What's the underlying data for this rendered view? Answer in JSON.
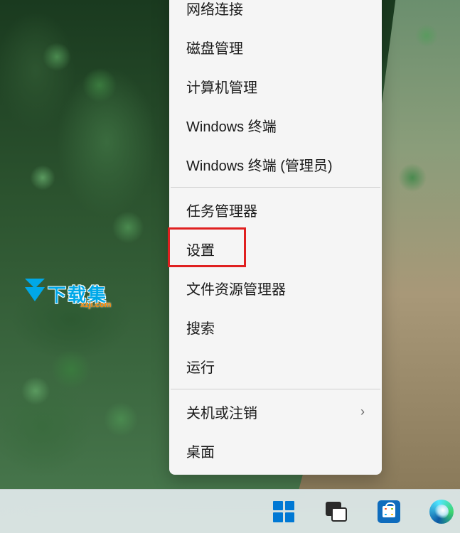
{
  "watermark": {
    "text": "下载集",
    "sub": "xzji.com"
  },
  "menu": {
    "items": [
      {
        "label": "网络连接",
        "submenu": false
      },
      {
        "label": "磁盘管理",
        "submenu": false
      },
      {
        "label": "计算机管理",
        "submenu": false
      },
      {
        "label": "Windows 终端",
        "submenu": false
      },
      {
        "label": "Windows 终端 (管理员)",
        "submenu": false
      },
      {
        "label": "任务管理器",
        "submenu": false
      },
      {
        "label": "设置",
        "submenu": false,
        "highlighted": true
      },
      {
        "label": "文件资源管理器",
        "submenu": false
      },
      {
        "label": "搜索",
        "submenu": false
      },
      {
        "label": "运行",
        "submenu": false
      },
      {
        "label": "关机或注销",
        "submenu": true
      },
      {
        "label": "桌面",
        "submenu": false
      }
    ]
  },
  "taskbar": {
    "start": "开始",
    "taskview": "任务视图",
    "store": "Microsoft Store",
    "edge": "Microsoft Edge"
  }
}
